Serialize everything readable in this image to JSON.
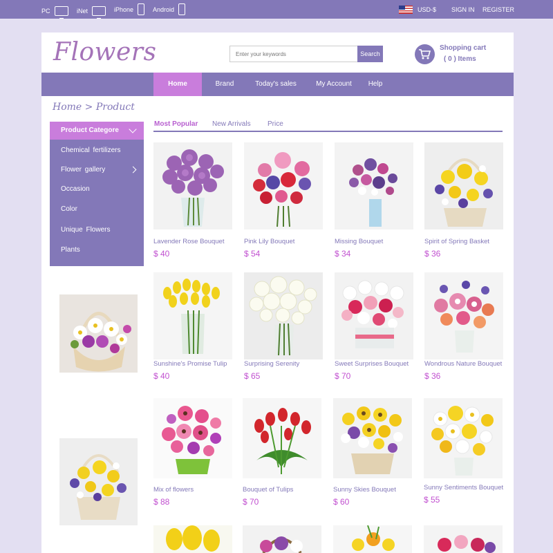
{
  "topbar": {
    "devices": [
      {
        "label": "PC",
        "icon": "monitor-icon"
      },
      {
        "label": "iNet",
        "icon": "monitor-icon"
      },
      {
        "label": "iPhone",
        "icon": "phone-icon"
      },
      {
        "label": "Android",
        "icon": "phone-icon"
      }
    ],
    "currency": "USD-$",
    "sign_in": "SIGN IN",
    "register": "REGISTER"
  },
  "header": {
    "logo": "Flowers",
    "search_placeholder": "Enter your keywords",
    "search_button": "Search",
    "cart_title": "Shopping cart",
    "cart_count": "( 0 )  Items"
  },
  "nav": [
    "Home",
    "Brand",
    "Today's sales",
    "My Account",
    "Help"
  ],
  "breadcrumb": "Home  >  Product",
  "sidebar": {
    "title": "Product  Categore",
    "items": [
      "Chemical  fertilizers",
      "Flower  gallery",
      "Occasion",
      "Color",
      "Unique  Flowers",
      "Plants"
    ]
  },
  "tabs": [
    "Most Popular",
    "New Arrivals",
    "Price"
  ],
  "products": [
    {
      "name": "Lavender Rose Bouquet",
      "price": "$ 40"
    },
    {
      "name": "Pink Lily Bouquet",
      "price": "$ 54"
    },
    {
      "name": "Missing Bouquet",
      "price": "$ 34"
    },
    {
      "name": "Spirit of Spring Basket",
      "price": "$ 36"
    },
    {
      "name": "Sunshine's Promise Tulip",
      "price": "$ 40"
    },
    {
      "name": "Surprising Serenity",
      "price": "$ 65"
    },
    {
      "name": "Sweet Surprises Bouquet",
      "price": "$ 70"
    },
    {
      "name": "Wondrous Nature Bouquet",
      "price": "$ 36"
    },
    {
      "name": "Mix of flowers",
      "price": "$ 88"
    },
    {
      "name": "Bouquet of Tulips",
      "price": "$ 70"
    },
    {
      "name": "Sunny Skies Bouquet",
      "price": "$ 60"
    },
    {
      "name": "Sunny Sentiments Bouquet",
      "price": "$ 55"
    }
  ],
  "colors": {
    "accent": "#8378b8",
    "highlight": "#c97ddc",
    "price": "#c150d0"
  }
}
